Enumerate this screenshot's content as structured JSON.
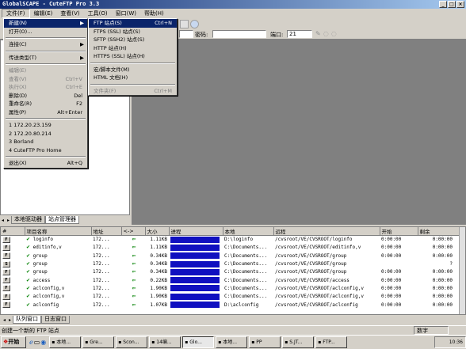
{
  "window": {
    "title": "GlobalSCAPE - CuteFTP Pro 3.3",
    "min": "_",
    "max": "□",
    "close": "×"
  },
  "menu": {
    "items": [
      "文件(F)",
      "编辑(E)",
      "查看(V)",
      "工具(O)",
      "窗口(W)",
      "帮助(H)"
    ]
  },
  "address_bar": {
    "password_label": "密码:",
    "port_label": "端口:",
    "port_value": "21"
  },
  "file_menu": {
    "items": [
      {
        "label": "新建(N)",
        "shortcut": "",
        "arrow": "▶",
        "state": "highlight"
      },
      {
        "label": "打开(O)...",
        "shortcut": "",
        "arrow": "",
        "state": ""
      },
      {
        "sep": true
      },
      {
        "label": "连接(C)",
        "shortcut": "",
        "arrow": "▶",
        "state": ""
      },
      {
        "sep": true
      },
      {
        "label": "传送类型(T)",
        "shortcut": "",
        "arrow": "▶",
        "state": ""
      },
      {
        "sep": true
      },
      {
        "label": "编辑(E)",
        "shortcut": "",
        "arrow": "",
        "state": "disabled"
      },
      {
        "label": "查看(V)",
        "shortcut": "Ctrl+V",
        "arrow": "",
        "state": "disabled"
      },
      {
        "label": "执行(X)",
        "shortcut": "Ctrl+E",
        "arrow": "",
        "state": "disabled"
      },
      {
        "label": "删除(D)",
        "shortcut": "Del",
        "arrow": "",
        "state": ""
      },
      {
        "label": "重命名(R)",
        "shortcut": "F2",
        "arrow": "",
        "state": ""
      },
      {
        "label": "属性(P)",
        "shortcut": "Alt+Enter",
        "arrow": "",
        "state": ""
      },
      {
        "sep": true
      },
      {
        "label": "1 172.20.23.159",
        "shortcut": "",
        "arrow": "",
        "state": ""
      },
      {
        "label": "2 172.20.80.214",
        "shortcut": "",
        "arrow": "",
        "state": ""
      },
      {
        "label": "3 Borland",
        "shortcut": "",
        "arrow": "",
        "state": ""
      },
      {
        "label": "4 CuteFTP Pro Home",
        "shortcut": "",
        "arrow": "",
        "state": ""
      },
      {
        "sep": true
      },
      {
        "label": "退出(X)",
        "shortcut": "Alt+Q",
        "arrow": "",
        "state": ""
      }
    ]
  },
  "new_submenu": {
    "items": [
      {
        "label": "FTP 站点(S)",
        "shortcut": "Ctrl+N",
        "state": "highlight"
      },
      {
        "label": "FTPS (SSL) 站点(S)",
        "shortcut": "",
        "state": ""
      },
      {
        "label": "SFTP (SSH2) 站点(S)",
        "shortcut": "",
        "state": ""
      },
      {
        "label": "HTTP 站点(H)",
        "shortcut": "",
        "state": ""
      },
      {
        "label": "HTTPS (SSL) 站点(H)",
        "shortcut": "",
        "state": ""
      },
      {
        "sep": true
      },
      {
        "label": "宏/脚本文件(M)",
        "shortcut": "",
        "state": ""
      },
      {
        "label": "HTML 文档(H)",
        "shortcut": "",
        "state": ""
      },
      {
        "sep": true
      },
      {
        "label": "文件夹(F)",
        "shortcut": "Ctrl+M",
        "state": "disabled"
      }
    ]
  },
  "left_tabs": [
    "本地驱动器",
    "站点管理器"
  ],
  "queue": {
    "headers": [
      "#",
      "项目名称",
      "地址",
      "<->",
      "大小",
      "进程",
      "本地",
      "远程",
      "开始",
      "剩余"
    ],
    "rows": [
      {
        "status": "F",
        "name": "loginfo",
        "addr": "172...",
        "size": "1.11KB",
        "local": "D:\\loginfo",
        "remote": "/cvsroot/VE/CVSROOT/loginfo",
        "start": "0:00:00",
        "remain": "0:00:00"
      },
      {
        "status": "F",
        "name": "editinfo,v",
        "addr": "172...",
        "size": "1.11KB",
        "local": "C:\\Documents...",
        "remote": "/cvsroot/VE/CVSROOT/editinfo,v",
        "start": "0:00:00",
        "remain": "0:00:00"
      },
      {
        "status": "F",
        "name": "group",
        "addr": "172...",
        "size": "0.34KB",
        "local": "C:\\Documents...",
        "remote": "/cvsroot/VE/CVSROOT/group",
        "start": "0:00:00",
        "remain": "0:00:00"
      },
      {
        "status": "S",
        "name": "group",
        "addr": "172...",
        "size": "0.34KB",
        "local": "C:\\Documents...",
        "remote": "/cvsroot/VE/CVSROOT/group",
        "start": "",
        "remain": "?"
      },
      {
        "status": "F",
        "name": "group",
        "addr": "172...",
        "size": "0.34KB",
        "local": "C:\\Documents...",
        "remote": "/cvsroot/VE/CVSROOT/group",
        "start": "0:00:00",
        "remain": "0:00:00"
      },
      {
        "status": "F",
        "name": "access",
        "addr": "172...",
        "size": "0.22KB",
        "local": "C:\\Documents...",
        "remote": "/cvsroot/VE/CVSROOT/access",
        "start": "0:00:00",
        "remain": "0:00:00"
      },
      {
        "status": "F",
        "name": "aclconfig,v",
        "addr": "172...",
        "size": "1.90KB",
        "local": "C:\\Documents...",
        "remote": "/cvsroot/VE/CVSROOT/aclconfig,v",
        "start": "0:00:00",
        "remain": "0:00:00"
      },
      {
        "status": "F",
        "name": "aclconfig,v",
        "addr": "172...",
        "size": "1.90KB",
        "local": "C:\\Documents...",
        "remote": "/cvsroot/VE/CVSROOT/aclconfig,v",
        "start": "0:00:00",
        "remain": "0:00:00"
      },
      {
        "status": "F",
        "name": "aclconfig",
        "addr": "172...",
        "size": "1.07KB",
        "local": "D:\\aclconfig",
        "remote": "/cvsroot/VE/CVSROOT/aclconfig",
        "start": "0:00:00",
        "remain": "0:00:00"
      }
    ]
  },
  "bottom_tabs": [
    "队列窗口",
    "日志窗口"
  ],
  "status": {
    "text": "创建一个新的 FTP 站点",
    "num": "数字"
  },
  "taskbar": {
    "start": "开始",
    "buttons": [
      "本地...",
      "Gre...",
      "Scon...",
      "14编...",
      "Glo...",
      "本地...",
      "PP",
      "S.JT...",
      "FTP..."
    ],
    "clock": "10:36"
  },
  "colors": {
    "title_start": "#0a246a",
    "highlight": "#0a246a",
    "progress": "#1010c0"
  }
}
